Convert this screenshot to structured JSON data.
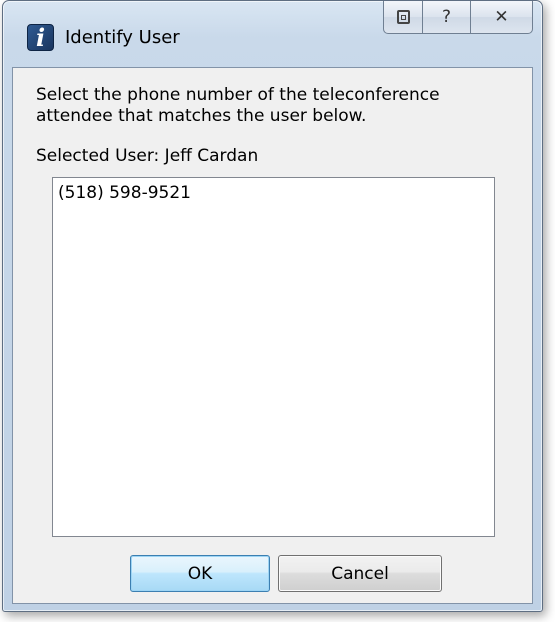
{
  "window": {
    "title": "Identify User",
    "app_icon_glyph": "i",
    "caption_buttons": {
      "context_icon": "context-help-icon",
      "help_glyph": "?",
      "close_glyph": "✕"
    }
  },
  "dialog": {
    "instruction": "Select the phone number of the teleconference attendee that matches the user below.",
    "selected_user_label": "Selected User: Jeff Cardan",
    "phone_list": [
      "(518) 598-9521"
    ],
    "ok_label": "OK",
    "cancel_label": "Cancel"
  },
  "colors": {
    "ok_border": "#3c7fb1",
    "frame": "#bfd1e5",
    "client_bg": "#f0f0f0"
  }
}
